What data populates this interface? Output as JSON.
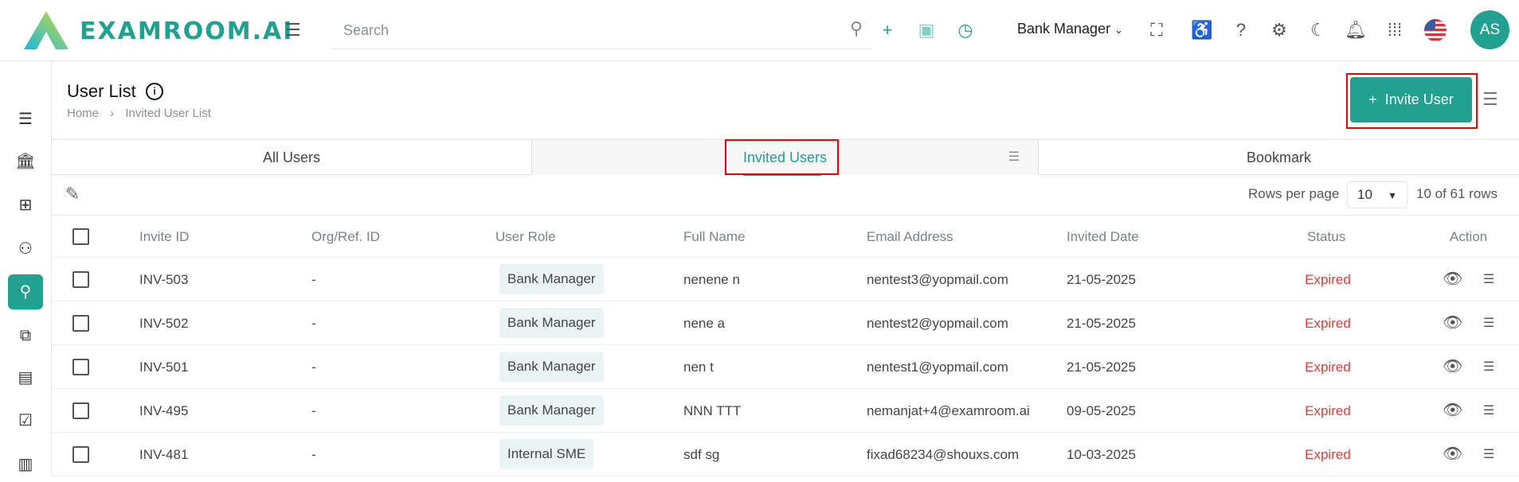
{
  "header": {
    "logo": "EXAMROOM.AI",
    "search_placeholder": "Search",
    "role": "Bank Manager",
    "avatar": "AS"
  },
  "page": {
    "title": "User List",
    "breadcrumb": [
      "Home",
      "Invited User List"
    ],
    "invite_button": "Invite User"
  },
  "tabs": [
    {
      "label": "All Users"
    },
    {
      "label": "Invited Users"
    },
    {
      "label": "Bookmark"
    }
  ],
  "toolbar": {
    "rows_per_page_label": "Rows per page",
    "rows_per_page": "10",
    "count": "10 of 61 rows"
  },
  "table": {
    "headers": [
      "Invite ID",
      "Org/Ref. ID",
      "User Role",
      "Full Name",
      "Email Address",
      "Invited Date",
      "Status",
      "Action"
    ],
    "rows": [
      {
        "id": "INV-503",
        "org": "-",
        "role": "Bank Manager",
        "name": "nenene n",
        "email": "nentest3@yopmail.com",
        "date": "21-05-2025",
        "status": "Expired"
      },
      {
        "id": "INV-502",
        "org": "-",
        "role": "Bank Manager",
        "name": "nene a",
        "email": "nentest2@yopmail.com",
        "date": "21-05-2025",
        "status": "Expired"
      },
      {
        "id": "INV-501",
        "org": "-",
        "role": "Bank Manager",
        "name": "nen t",
        "email": "nentest1@yopmail.com",
        "date": "21-05-2025",
        "status": "Expired"
      },
      {
        "id": "INV-495",
        "org": "-",
        "role": "Bank Manager",
        "name": "NNN TTT",
        "email": "nemanjat+4@examroom.ai",
        "date": "09-05-2025",
        "status": "Expired"
      },
      {
        "id": "INV-481",
        "org": "-",
        "role": "Internal SME",
        "name": "sdf sg",
        "email": "fixad68234@shouxs.com",
        "date": "10-03-2025",
        "status": "Expired"
      }
    ]
  },
  "colors": {
    "accent": "#22a090",
    "expired": "#d9403a"
  }
}
